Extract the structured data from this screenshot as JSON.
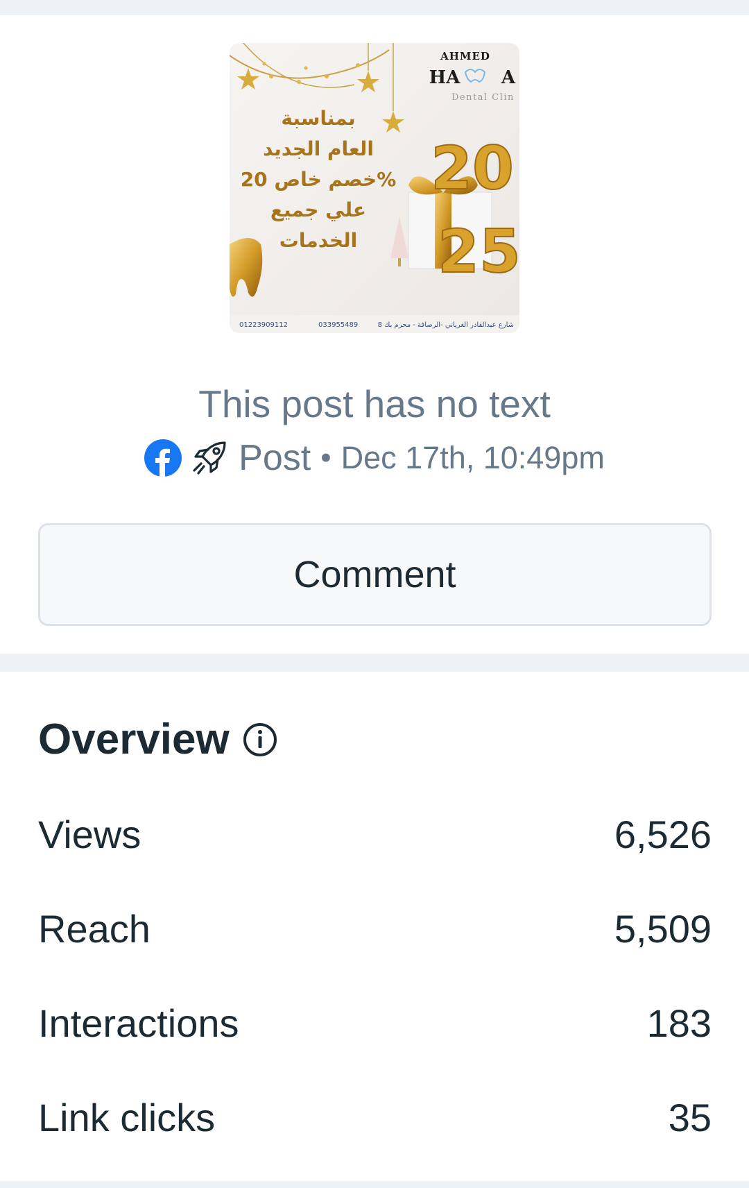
{
  "post": {
    "image": {
      "brand_line1": "AHMED",
      "brand_line2": "HA",
      "brand_line2b": "A",
      "brand_line3": "Dental Clin",
      "arabic_lines": [
        "بمناسبة",
        "العام الجديد",
        "خصم خاص 20%",
        "علي جميع",
        "الخدمات"
      ],
      "year_top": "20",
      "year_bottom": "25",
      "footer_phone1": "01223909112",
      "footer_phone2": "033955489",
      "footer_address": "8 شارع عبدالقادر الغرياني -الرصافة - محرم بك",
      "gold_color": "#d9a22d"
    },
    "no_text_label": "This post has no text",
    "platform_icon": "facebook-icon",
    "boost_icon": "rocket-icon",
    "type_label": "Post",
    "separator": "•",
    "date_label": "Dec 17th, 10:49pm"
  },
  "comment_button": {
    "label": "Comment"
  },
  "overview": {
    "title": "Overview",
    "info_icon": "info-icon",
    "metrics": [
      {
        "label": "Views",
        "value": "6,526"
      },
      {
        "label": "Reach",
        "value": "5,509"
      },
      {
        "label": "Interactions",
        "value": "183"
      },
      {
        "label": "Link clicks",
        "value": "35"
      }
    ]
  },
  "colors": {
    "text_primary": "#1c2b33",
    "text_secondary": "#67788a",
    "facebook_blue": "#1877f2",
    "divider": "#eef1f5"
  }
}
